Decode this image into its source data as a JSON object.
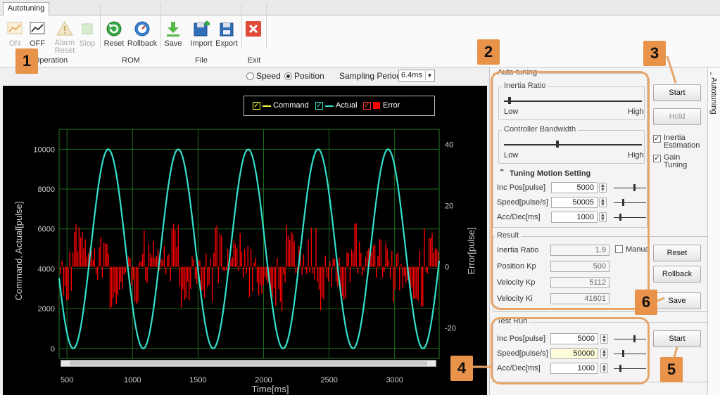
{
  "tab": {
    "label": "Autotuning"
  },
  "ribbon": {
    "groups": [
      {
        "label": "Operation"
      },
      {
        "label": "ROM"
      },
      {
        "label": "File"
      },
      {
        "label": "Exit"
      }
    ],
    "buttons": {
      "on": "ON",
      "off": "OFF",
      "alarm_reset": "Alarm Reset",
      "stop": "Stop",
      "reset": "Reset",
      "rollback": "Rollback",
      "save": "Save",
      "import": "Import",
      "export": "Export"
    }
  },
  "plot_options": {
    "speed": "Speed",
    "position": "Position",
    "sampling_label": "Sampling Period",
    "sampling_value": "6.4ms"
  },
  "colors": {
    "command": "#ffff33",
    "actual": "#33e0cc",
    "error": "#ff0000",
    "accent": "#e8924a"
  },
  "chart_data": {
    "type": "line",
    "legend": [
      "Command",
      "Actual",
      "Error"
    ],
    "xlabel": "Time[ms]",
    "ylabel": "Command, Actual[pulse]",
    "y2label": "Error[pulse]",
    "xlim": [
      440,
      3340
    ],
    "ylim": [
      -500,
      11000
    ],
    "y2lim": [
      -30,
      45
    ],
    "x_ticks": [
      500,
      1000,
      1500,
      2000,
      2500,
      3000
    ],
    "y_ticks": [
      0,
      2000,
      4000,
      6000,
      8000,
      10000
    ],
    "y2_ticks": [
      -20,
      0,
      20,
      40
    ],
    "series": [
      {
        "name": "Actual",
        "peaks_x": [
          815,
          1345,
          1880,
          2415,
          2950
        ],
        "troughs_x": [
          540,
          1080,
          1610,
          2150,
          2680,
          3220
        ],
        "min": 0,
        "max": 10000
      },
      {
        "name": "Error",
        "center": 0,
        "amplitude": 15
      }
    ],
    "grid": true,
    "legend_placement": "top-center"
  },
  "autotuning": {
    "title": "Auto-tuning",
    "inertia_ratio": {
      "title": "Inertia Ratio",
      "low": "Low",
      "high": "High"
    },
    "controller_bw": {
      "title": "Controller Bandwidth",
      "low": "Low",
      "high": "High"
    },
    "motion": {
      "title": "Tuning Motion Setting",
      "inc_pos_label": "Inc Pos[pulse]",
      "inc_pos": "5000",
      "speed_label": "Speed[pulse/s]",
      "speed": "50005",
      "acc_label": "Acc/Dec[ms]",
      "acc": "1000"
    },
    "start": "Start",
    "hold": "Hold",
    "inertia_est": "Inertia Estimation",
    "gain_tuning": "Gain Tuning"
  },
  "result": {
    "title": "Result",
    "inertia_label": "Inertia Ratio",
    "inertia": "1.9",
    "manual": "Manua",
    "pos_kp_label": "Position Kp",
    "pos_kp": "500",
    "vel_kp_label": "Velocity Kp",
    "vel_kp": "5112",
    "vel_ki_label": "Velocity Ki",
    "vel_ki": "41601",
    "reset": "Reset",
    "rollback": "Rollback",
    "save": "Save"
  },
  "test_run": {
    "title": "Test Run",
    "inc_pos_label": "Inc Pos[pulse]",
    "inc_pos": "5000",
    "speed_label": "Speed[pulse/s]",
    "speed": "50000",
    "acc_label": "Acc/Dec[ms]",
    "acc": "1000",
    "start": "Start"
  },
  "side_tab": {
    "label": "Autotuning"
  },
  "badges": [
    "1",
    "2",
    "3",
    "4",
    "5",
    "6"
  ]
}
